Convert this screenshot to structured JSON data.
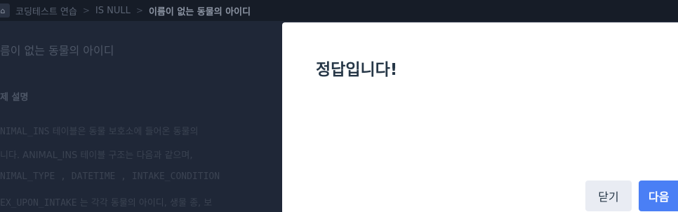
{
  "breadcrumb": {
    "items": [
      "코딩테스트 연습",
      "IS NULL"
    ],
    "separator": ">",
    "current": "이름이 없는 동물의 아이디"
  },
  "background": {
    "title": "름이 없는 동물의 아이디",
    "section": "제 설명",
    "lines": [
      {
        "code": "NIMAL_INS",
        "text": " 테이블은 동물 보호소에 들어온 동물의"
      },
      {
        "code": "",
        "text": "니다. ANIMAL_INS 테이블 구조는 다음과 같으며,"
      },
      {
        "code": "NIMAL_TYPE , DATETIME , INTAKE_CONDITION",
        "text": ""
      },
      {
        "code": "EX_UPON_INTAKE",
        "text": " 는 각각 동물의 아이디, 생물 종, 보"
      }
    ]
  },
  "modal": {
    "title": "정답입니다!",
    "close_label": "닫기",
    "next_label": "다음"
  },
  "colors": {
    "accent": "#4a7ff5",
    "overlay": "#1f2737"
  }
}
